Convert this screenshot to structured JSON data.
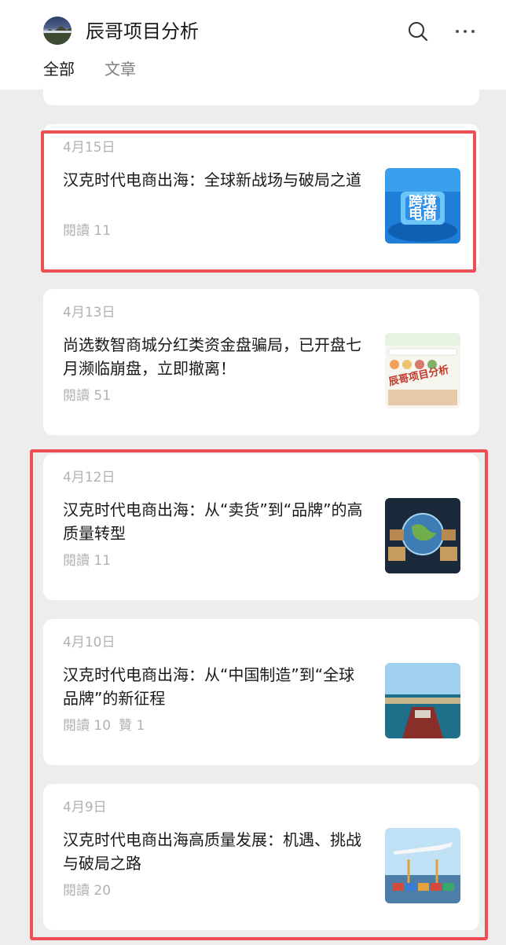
{
  "header": {
    "title": "辰哥项目分析",
    "tabs": [
      {
        "label": "全部",
        "active": true
      },
      {
        "label": "文章",
        "active": false
      }
    ]
  },
  "articles": [
    {
      "date": "4月15日",
      "title": "汉克时代电商出海：全球新战场与破局之道",
      "reads": "閱讀 11",
      "likes": "",
      "thumb_text": "跨境电商"
    },
    {
      "date": "4月13日",
      "title": "尚选数智商城分红类资金盘骗局，已开盘七月濒临崩盘，立即撤离！",
      "reads": "閱讀 51",
      "likes": "",
      "thumb_text": "辰哥项目分析"
    },
    {
      "date": "4月12日",
      "title": "汉克时代电商出海：从“卖货”到“品牌”的高质量转型",
      "reads": "閱讀 11",
      "likes": ""
    },
    {
      "date": "4月10日",
      "title": "汉克时代电商出海：从“中国制造”到“全球品牌”的新征程",
      "reads": "閱讀 10",
      "likes": "贊 1"
    },
    {
      "date": "4月9日",
      "title": "汉克时代电商出海高质量发展：机遇、挑战与破局之路",
      "reads": "閱讀 20",
      "likes": ""
    }
  ],
  "colors": {
    "highlight": "#ee4f54",
    "background": "#ededed",
    "card": "#ffffff",
    "text_primary": "#191919",
    "text_secondary": "#b2b2b2"
  }
}
